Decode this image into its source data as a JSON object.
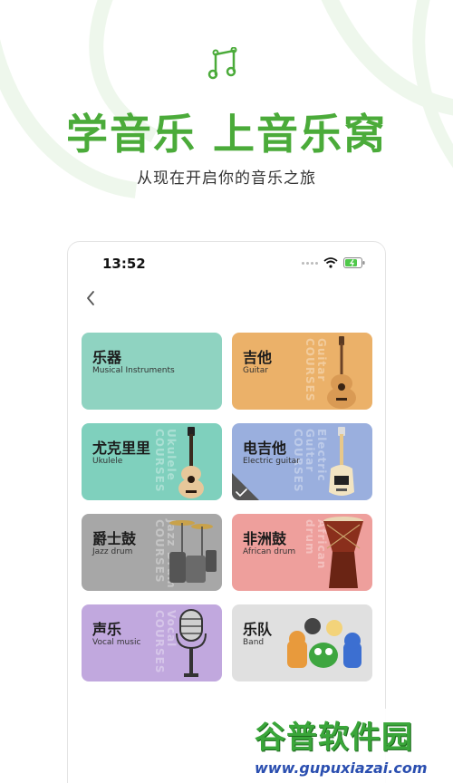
{
  "header": {
    "headline": "学音乐 上音乐窝",
    "subhead": "从现在开启你的音乐之旅"
  },
  "status_bar": {
    "time": "13:52"
  },
  "categories": [
    {
      "title": "乐器",
      "subtitle": "Musical Instruments",
      "color": "#8fd3c1",
      "watermark": ""
    },
    {
      "title": "吉他",
      "subtitle": "Guitar",
      "color": "#ebb169",
      "watermark": "Guitar COURSES"
    },
    {
      "title": "尤克里里",
      "subtitle": "Ukulele",
      "color": "#7fd0bd",
      "watermark": "Ukulele COURSES"
    },
    {
      "title": "电吉他",
      "subtitle": "Electric guitar",
      "color": "#9aafde",
      "watermark": "Electric Guitar COURSES"
    },
    {
      "title": "爵士鼓",
      "subtitle": "Jazz drum",
      "color": "#a7a7a7",
      "watermark": "Jazz Drum COURSES"
    },
    {
      "title": "非洲鼓",
      "subtitle": "African drum",
      "color": "#ee9f9c",
      "watermark": "African drum"
    },
    {
      "title": "声乐",
      "subtitle": "Vocal music",
      "color": "#c1a8de",
      "watermark": "Vocal COURSES"
    },
    {
      "title": "乐队",
      "subtitle": "Band",
      "color": "#e0e0e0",
      "watermark": ""
    }
  ],
  "site_watermark": {
    "brand": "谷普软件园",
    "url": "www.gupuxiazai.com"
  },
  "colors": {
    "accent": "#4bab3a"
  },
  "icons": [
    "music-note-icon",
    "back-chevron-icon",
    "wifi-icon",
    "battery-icon",
    "signal-icon",
    "check-icon"
  ]
}
